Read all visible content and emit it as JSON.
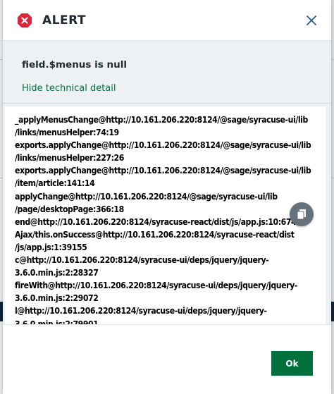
{
  "dialog": {
    "title": "ALERT",
    "close_label": "close",
    "message": "field.$menus is null",
    "toggle_link": "Hide technical detail",
    "stack_lines": [
      "_applyMenusChange@http://10.161.206.220:8124/@sage/syracuse-ui/lib",
      "/links/menusHelper:74:19",
      "exports.applyChange@http://10.161.206.220:8124/@sage/syracuse-ui/lib",
      "/links/menusHelper:227:26",
      "exports.applyChange@http://10.161.206.220:8124/@sage/syracuse-ui/lib",
      "/item/article:141:14",
      "applyChange@http://10.161.206.220:8124/@sage/syracuse-ui/lib",
      "/page/desktopPage:366:18",
      "end@http://10.161.206.220:8124/syracuse-react/dist/js/app.js:10:67424",
      "Ajax/this.onSuccess@http://10.161.206.220:8124/syracuse-react/dist",
      "/js/app.js:1:39155",
      "c@http://10.161.206.220:8124/syracuse-ui/deps/jquery/jquery-",
      "3.6.0.min.js:2:28327",
      "fireWith@http://10.161.206.220:8124/syracuse-ui/deps/jquery/jquery-",
      "3.6.0.min.js:2:29072",
      "l@http://10.161.206.220:8124/syracuse-ui/deps/jquery/jquery-",
      "3.6.0.min.js:2:79901",
      "..."
    ],
    "ok_label": "Ok"
  },
  "icons": {
    "alert": "alert-x-icon",
    "close": "close-icon",
    "copy": "copy-icon"
  },
  "colors": {
    "accent": "#00703c",
    "alert_red": "#e0243c",
    "copy_button": "#66727b"
  }
}
